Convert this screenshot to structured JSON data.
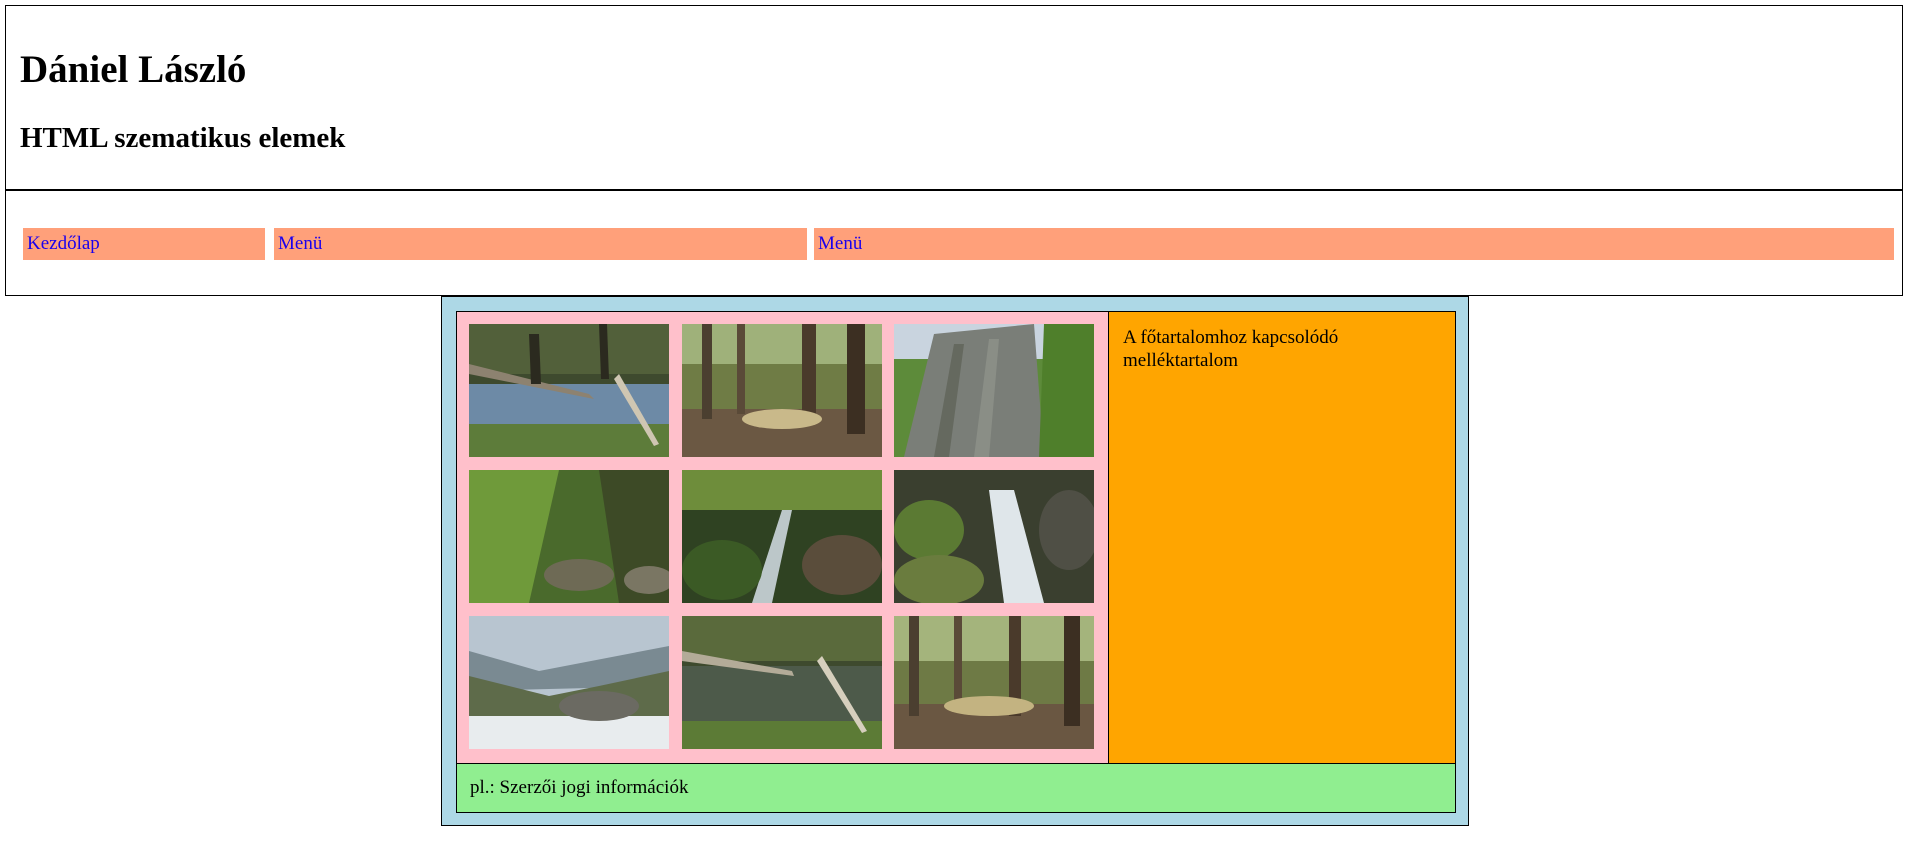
{
  "header": {
    "title": "Dániel László",
    "subtitle": "HTML szematikus elemek"
  },
  "nav": {
    "items": [
      {
        "label": "Kezdőlap"
      },
      {
        "label": "Menü"
      },
      {
        "label": "Menü"
      }
    ]
  },
  "gallery": {
    "photos": [
      {
        "name": "fallen-trees-stream-photo"
      },
      {
        "name": "forest-path-photo"
      },
      {
        "name": "rock-cliff-photo"
      },
      {
        "name": "fern-gorge-photo"
      },
      {
        "name": "mossy-stream-photo"
      },
      {
        "name": "waterfall-rocks-photo"
      },
      {
        "name": "mountain-valley-snow-photo"
      },
      {
        "name": "fallen-trees-pond-photo"
      },
      {
        "name": "forest-clearing-photo"
      }
    ]
  },
  "aside": {
    "text": "A főtartalomhoz kapcsolódó melléktartalom"
  },
  "footer": {
    "text": "pl.: Szerzői jogi információk"
  },
  "colors": {
    "nav_background": "#ffa07a",
    "link": "#1a00ee",
    "wrapper": "#add8e6",
    "main": "#ffc0cb",
    "aside": "#ffa500",
    "footer": "#90ee90"
  }
}
